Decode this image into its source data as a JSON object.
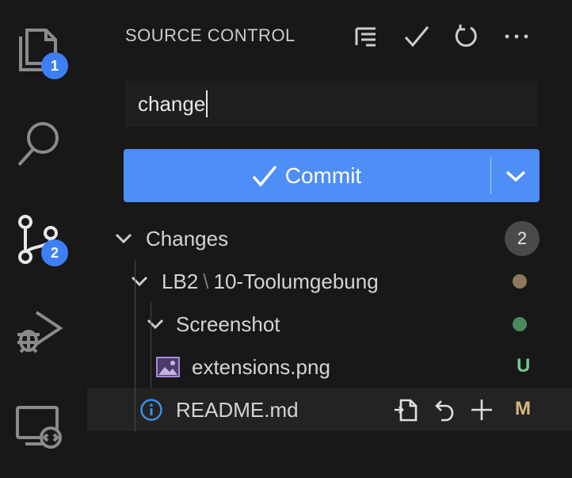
{
  "activity_bar": {
    "explorer_badge": "1",
    "source_control_badge": "2"
  },
  "header": {
    "title": "SOURCE CONTROL"
  },
  "commit": {
    "message_value": "change",
    "button_label": "Commit"
  },
  "changes": {
    "group_label": "Changes",
    "count": "2",
    "folder_path": [
      "LB2",
      "10-Toolumgebung"
    ],
    "subfolder": "Screenshot",
    "files": [
      {
        "name": "extensions.png",
        "status": "U",
        "status_color": "#73c991"
      },
      {
        "name": "README.md",
        "status": "M",
        "status_color": "#d7ba7d"
      }
    ]
  },
  "colors": {
    "accent": "#4d8ef7",
    "folder_dot_modified": "#8c7a5b",
    "folder_dot_untracked": "#4a8a5f"
  }
}
